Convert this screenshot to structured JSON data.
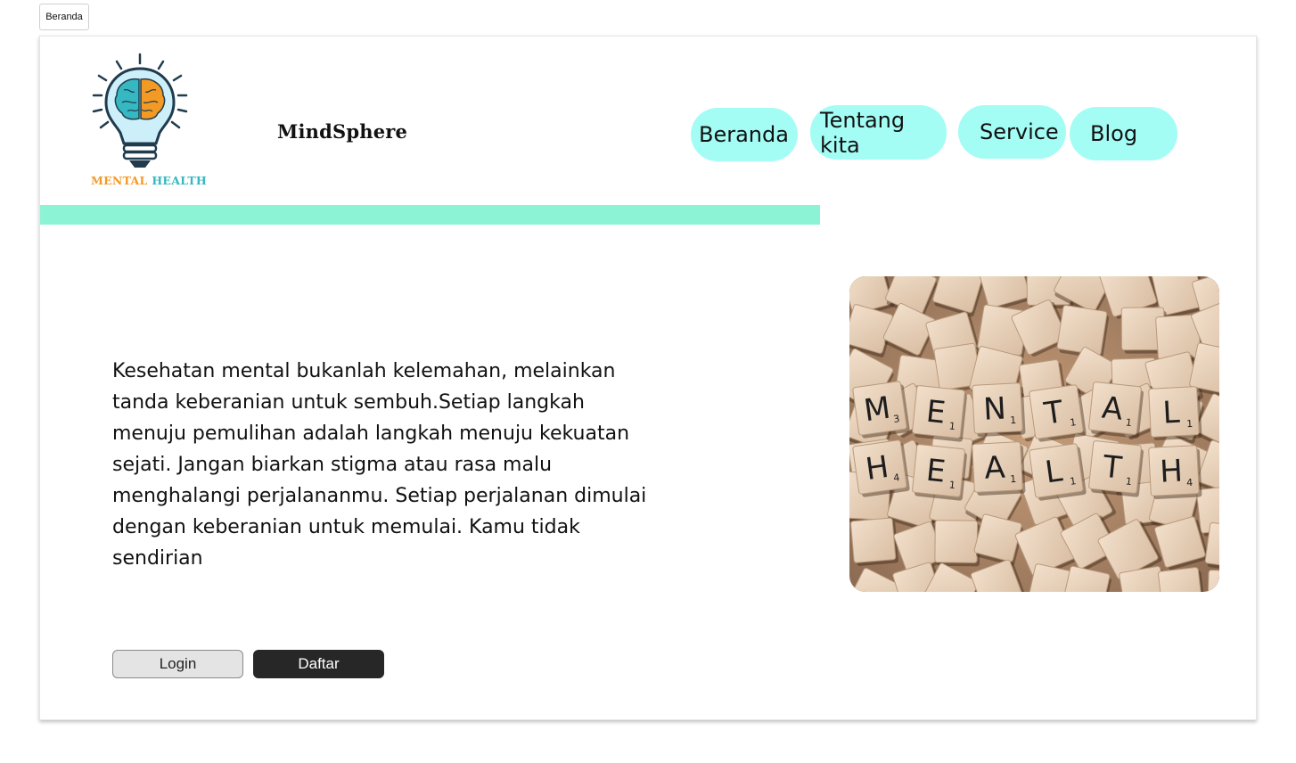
{
  "browser_tab": {
    "label": "Beranda"
  },
  "header": {
    "logo_text": {
      "word1": "MENTAL",
      "word2": "HEALTH"
    },
    "brand": "MindSphere",
    "nav": [
      {
        "label": "Beranda"
      },
      {
        "label": "Tentang kita"
      },
      {
        "label": "Service"
      },
      {
        "label": "Blog"
      }
    ]
  },
  "hero": {
    "text": "Kesehatan mental bukanlah kelemahan, melainkan tanda keberanian untuk sembuh.Setiap langkah menuju pemulihan adalah langkah menuju kekuatan sejati. Jangan biarkan stigma atau rasa malu menghalangi perjalananmu. Setiap perjalanan dimulai dengan keberanian untuk memulai. Kamu tidak sendirian",
    "login_label": "Login",
    "register_label": "Daftar"
  },
  "image": {
    "tiles_row1": [
      "M",
      "E",
      "N",
      "T",
      "A",
      "L"
    ],
    "tiles_row1_scores": [
      "3",
      "1",
      "1",
      "1",
      "1",
      "1"
    ],
    "tiles_row2": [
      "H",
      "E",
      "A",
      "L",
      "T",
      "H"
    ],
    "tiles_row2_scores": [
      "4",
      "1",
      "1",
      "1",
      "1",
      "4"
    ]
  },
  "colors": {
    "nav_pill": "#a3fdf5",
    "accent_bar": "#8cf3d5",
    "logo_orange": "#f39a25",
    "logo_teal": "#35b8c2",
    "primary_button": "#272727"
  }
}
